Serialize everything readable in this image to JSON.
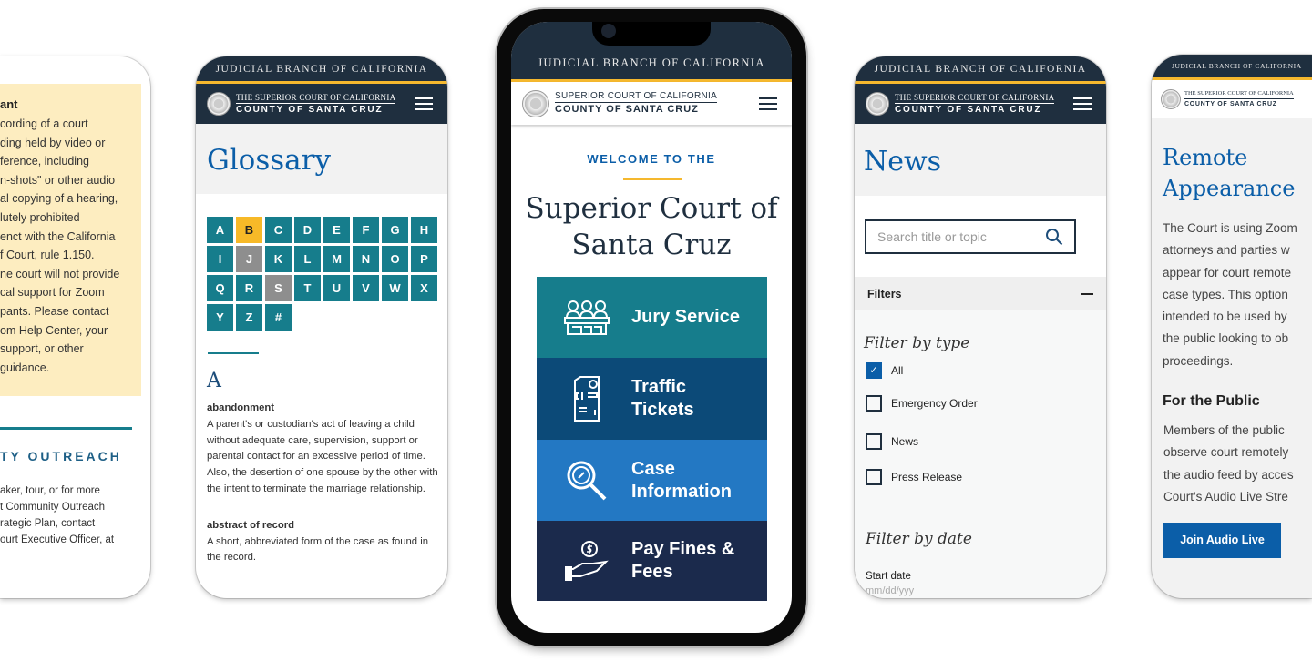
{
  "common": {
    "judicial": "JUDICIAL BRANCH OF CALIFORNIA",
    "logo_line1": "THE SUPERIOR COURT OF CALIFORNIA",
    "logo_line1_home": "SUPERIOR COURT OF CALIFORNIA",
    "logo_line2": "COUNTY OF SANTA CRUZ",
    "colors": {
      "navy": "#1f2f3f",
      "gold": "#f5b82e",
      "teal": "#167d8c",
      "blue": "#0b5ea8"
    }
  },
  "phone1": {
    "notice_title": "ant",
    "notice_lines": [
      "cording of a court",
      "ding held by video or",
      "ference, including",
      "n-shots\" or other audio",
      "al copying of a hearing,",
      "lutely prohibited",
      "enct with the California",
      "f Court, rule 1.150.",
      "ne court will not provide",
      "cal support for Zoom",
      "pants. Please contact",
      "om Help Center, your",
      "support, or other",
      "guidance."
    ],
    "section_title": "TY OUTREACH",
    "section_lines": [
      "aker, tour, or for more",
      "t Community Outreach",
      "rategic Plan, contact",
      "ourt Executive Officer, at"
    ]
  },
  "glossary": {
    "title": "Glossary",
    "letters": [
      "A",
      "B",
      "C",
      "D",
      "E",
      "F",
      "G",
      "H",
      "I",
      "J",
      "K",
      "L",
      "M",
      "N",
      "O",
      "P",
      "Q",
      "R",
      "S",
      "T",
      "U",
      "V",
      "W",
      "X",
      "Y",
      "Z",
      "#"
    ],
    "selected": "B",
    "disabled": [
      "J",
      "S"
    ],
    "heading": "A",
    "terms": [
      {
        "term": "abandonment",
        "definition": "A parent's or custodian's act of leaving a child without adequate care, supervision, support or parental contact for an excessive period of time. Also, the desertion of one spouse by the other with the intent to terminate the marriage relationship."
      },
      {
        "term": "abstract of record",
        "definition": "A short, abbreviated form of the case as found in the record."
      }
    ]
  },
  "home": {
    "welcome": "WELCOME TO THE",
    "title": "Superior Court of Santa Cruz",
    "tiles": [
      {
        "label": "Jury Service",
        "icon": "jury-icon",
        "color": "#167d8c"
      },
      {
        "label": "Traffic\nTickets",
        "icon": "ticket-icon",
        "color": "#0c4a78"
      },
      {
        "label": "Case\nInformation",
        "icon": "magnifier-icon",
        "color": "#2378c3"
      },
      {
        "label": "Pay Fines &\nFees",
        "icon": "hand-coin-icon",
        "color": "#1b2a4c"
      }
    ]
  },
  "news": {
    "title": "News",
    "search_placeholder": "Search title or topic",
    "filters_label": "Filters",
    "filter_type_title": "Filter by type",
    "options": [
      {
        "label": "All",
        "checked": true
      },
      {
        "label": "Emergency Order",
        "checked": false
      },
      {
        "label": "News",
        "checked": false
      },
      {
        "label": "Press Release",
        "checked": false
      }
    ],
    "filter_date_title": "Filter by date",
    "start_date_label": "Start date",
    "start_date_placeholder": "mm/dd/yyy"
  },
  "remote": {
    "title": "Remote Appearance",
    "intro_lines": [
      "The Court is using Zoom",
      "attorneys and parties w",
      "appear for court remote",
      "case types. This option",
      "intended to be used by",
      "the public looking to ob",
      "proceedings."
    ],
    "public_heading": "For the Public",
    "public_lines": [
      "Members of the public",
      "observe court remotely",
      "the audio feed by acces",
      "Court's Audio Live Stre"
    ],
    "button": "Join Audio Live"
  }
}
